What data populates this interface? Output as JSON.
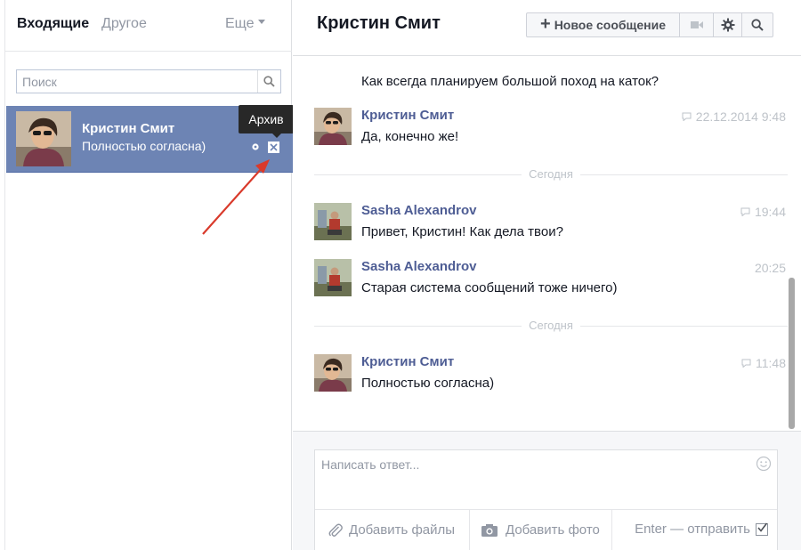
{
  "left": {
    "tabs": {
      "inbox": "Входящие",
      "other": "Другое",
      "more": "Еще"
    },
    "search": {
      "placeholder": "Поиск"
    },
    "conversation": {
      "name": "Кристин Смит",
      "snippet": "Полностью согласна)"
    },
    "tooltip": "Архив"
  },
  "header": {
    "title": "Кристин Смит",
    "new_message_label": "Новое сообщение"
  },
  "messages": {
    "plain_first": "Как всегда планируем большой поход на каток?",
    "items": [
      {
        "author": "Кристин Смит",
        "text": "Да, конечно же!",
        "time": "22.12.2014 9:48"
      },
      {
        "author": "Sasha Alexandrov",
        "text": "Привет, Кристин! Как дела твои?",
        "time": "19:44"
      },
      {
        "author": "Sasha Alexandrov",
        "text": "Старая система сообщений тоже ничего)",
        "time": "20:25"
      },
      {
        "author": "Кристин Смит",
        "text": "Полностью согласна)",
        "time": "11:48"
      }
    ],
    "day_separator_1": "Сегодня",
    "day_separator_2": "Сегодня"
  },
  "composer": {
    "placeholder": "Написать ответ...",
    "attach_label": "Добавить файлы",
    "photo_label": "Добавить фото",
    "enter_send_label": "Enter — отправить"
  },
  "colors": {
    "selected_conversation": "#6d84b4",
    "author_link": "#4e5d94",
    "tooltip_bg": "#282828",
    "arrow": "#d93a2b"
  }
}
